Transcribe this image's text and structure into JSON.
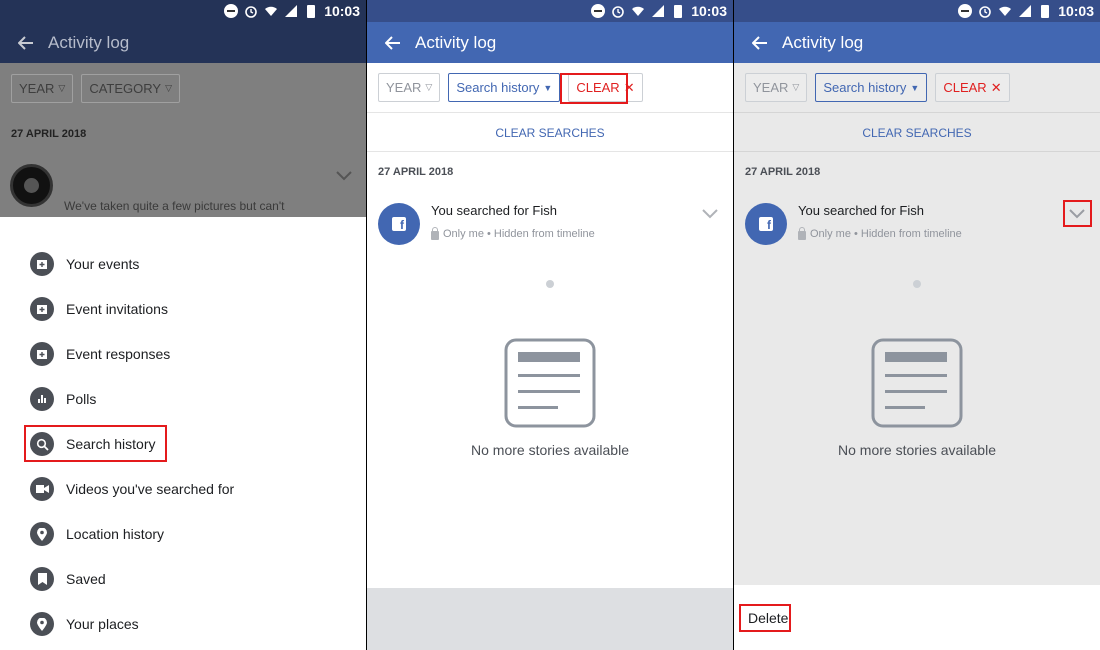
{
  "status_bar": {
    "time": "10:03"
  },
  "panel1": {
    "header_title": "Activity log",
    "filters": {
      "year": "YEAR",
      "category": "CATEGORY"
    },
    "date": "27 APRIL 2018",
    "snippet": "We've taken quite a few pictures but can't",
    "menu": [
      {
        "label": "Your events",
        "icon": "calendar-icon"
      },
      {
        "label": "Event invitations",
        "icon": "calendar-icon"
      },
      {
        "label": "Event responses",
        "icon": "calendar-icon"
      },
      {
        "label": "Polls",
        "icon": "poll-icon"
      },
      {
        "label": "Search history",
        "icon": "search-icon"
      },
      {
        "label": "Videos you've searched for",
        "icon": "video-icon"
      },
      {
        "label": "Location history",
        "icon": "location-pin-icon"
      },
      {
        "label": "Saved",
        "icon": "bookmark-icon"
      },
      {
        "label": "Your places",
        "icon": "location-pin-icon"
      }
    ]
  },
  "panel2": {
    "header_title": "Activity log",
    "filters": {
      "year": "YEAR",
      "search_history": "Search history",
      "clear": "CLEAR"
    },
    "clear_searches": "CLEAR SEARCHES",
    "date": "27 APRIL 2018",
    "entry": {
      "text": "You searched for Fish",
      "meta": "Only me • Hidden from timeline"
    },
    "empty_text": "No more stories available"
  },
  "panel3": {
    "header_title": "Activity log",
    "filters": {
      "year": "YEAR",
      "search_history": "Search history",
      "clear": "CLEAR"
    },
    "clear_searches": "CLEAR SEARCHES",
    "date": "27 APRIL 2018",
    "entry": {
      "text": "You searched for Fish",
      "meta": "Only me • Hidden from timeline"
    },
    "empty_text": "No more stories available",
    "delete_label": "Delete"
  },
  "colors": {
    "brand_blue": "#4267b2",
    "highlight_red": "#e41a1c",
    "clear_red": "#e02020"
  }
}
